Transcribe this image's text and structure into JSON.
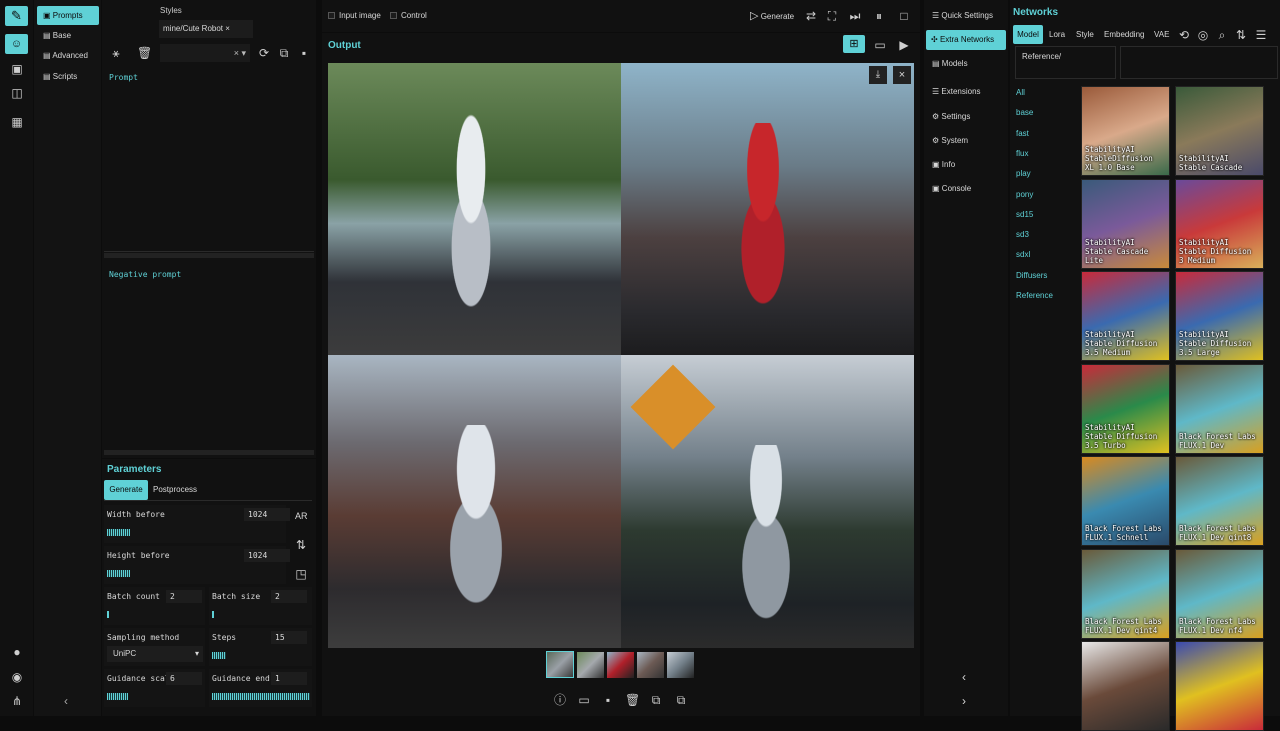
{
  "leftnav": {
    "icons": [
      "logo-icon",
      "robot-icon",
      "image-icon",
      "layout-icon",
      "calendar-icon"
    ],
    "bottom_icons": [
      "github-icon",
      "discord-icon",
      "sitemap-icon"
    ]
  },
  "tabs": {
    "prompts": "Prompts",
    "base": "Base",
    "advanced": "Advanced",
    "scripts": "Scripts"
  },
  "styles": {
    "label": "Styles",
    "chip": "mine/Cute Robot"
  },
  "prompt": {
    "label": "Prompt",
    "negative_label": "Negative prompt"
  },
  "top": {
    "input_image": "Input image",
    "control": "Control",
    "generate": "Generate"
  },
  "output": {
    "title": "Output"
  },
  "parameters": {
    "title": "Parameters",
    "tab_generate": "Generate",
    "tab_post": "Postprocess",
    "width_label": "Width before",
    "width_val": "1024",
    "width_frac": 0.13,
    "height_label": "Height before",
    "height_val": "1024",
    "height_frac": 0.13,
    "ar": "AR",
    "batch_count_label": "Batch count",
    "batch_count_val": "2",
    "batch_size_label": "Batch size",
    "batch_size_val": "2",
    "sampling_label": "Sampling method",
    "sampling_val": "UniPC",
    "steps_label": "Steps",
    "steps_val": "15",
    "guid_label": "Guidance scale",
    "guid_val": "6",
    "guid_end_label": "Guidance end",
    "guid_end_val": "1"
  },
  "menu": {
    "quick": "Quick Settings",
    "extra": "Extra Networks",
    "models": "Models",
    "extensions": "Extensions",
    "settings": "Settings",
    "system": "System",
    "info": "Info",
    "console": "Console"
  },
  "networks": {
    "title": "Networks",
    "tabs": [
      "Model",
      "Lora",
      "Style",
      "Embedding",
      "VAE"
    ],
    "path": "Reference/",
    "categories": [
      "All",
      "base",
      "fast",
      "flux",
      "play",
      "pony",
      "sd15",
      "sd3",
      "sdxl",
      "Diffusers",
      "Reference"
    ],
    "cards": [
      "StabilityAI StableDiffusion XL 1.0 Base",
      "StabilityAI Stable Cascade",
      "StabilityAI Stable Cascade Lite",
      "StabilityAI Stable Diffusion 3 Medium",
      "StabilityAI Stable Diffusion 3.5 Medium",
      "StabilityAI Stable Diffusion 3.5 Large",
      "StabilityAI Stable Diffusion 3.5 Turbo",
      "Black Forest Labs FLUX.1 Dev",
      "Black Forest Labs FLUX.1 Schnell",
      "Black Forest Labs FLUX.1 Dev qint8",
      "Black Forest Labs FLUX.1 Dev qint4",
      "Black Forest Labs FLUX.1 Dev nf4",
      "",
      ""
    ]
  }
}
